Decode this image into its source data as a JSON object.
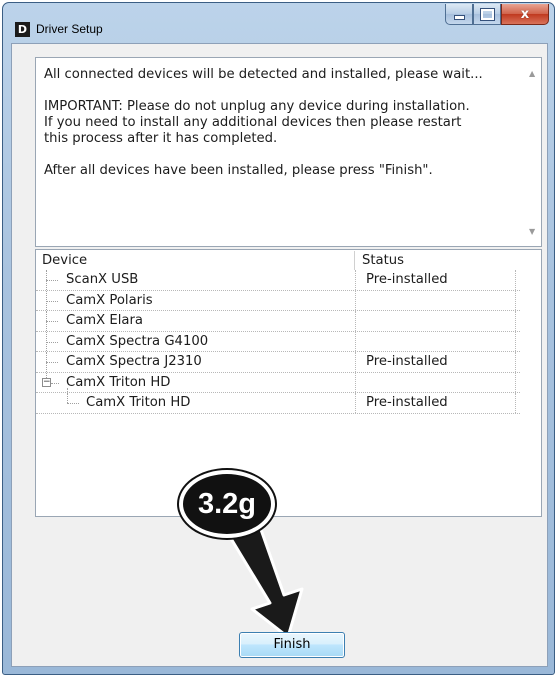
{
  "window": {
    "title": "Driver Setup",
    "icon_glyph": "D",
    "buttons": {
      "minimize": "minimize-icon",
      "maximize": "maximize-icon",
      "close_glyph": "x"
    }
  },
  "message": {
    "line1": "All connected devices will be detected and installed, please wait...",
    "line2": "IMPORTANT: Please do not unplug any device during installation.",
    "line3": "If you need to install any additional devices then please restart",
    "line4": "this process after it has completed.",
    "line5": "After all devices have been installed, please press \"Finish\"."
  },
  "device_list": {
    "headers": {
      "device": "Device",
      "status": "Status"
    },
    "rows": [
      {
        "device": "ScanX USB",
        "status": "Pre-installed"
      },
      {
        "device": "CamX Polaris",
        "status": ""
      },
      {
        "device": "CamX Elara",
        "status": ""
      },
      {
        "device": "CamX Spectra G4100",
        "status": ""
      },
      {
        "device": "CamX Spectra J2310",
        "status": "Pre-installed"
      },
      {
        "device": "CamX Triton HD",
        "status": ""
      },
      {
        "device": "CamX Triton HD",
        "status": "Pre-installed"
      }
    ]
  },
  "callout": {
    "label": "3.2g"
  },
  "footer": {
    "finish_label": "Finish"
  },
  "colors": {
    "frame": "#a9c3df",
    "close_button": "#c0391f",
    "finish_button": "#bee6fd"
  }
}
